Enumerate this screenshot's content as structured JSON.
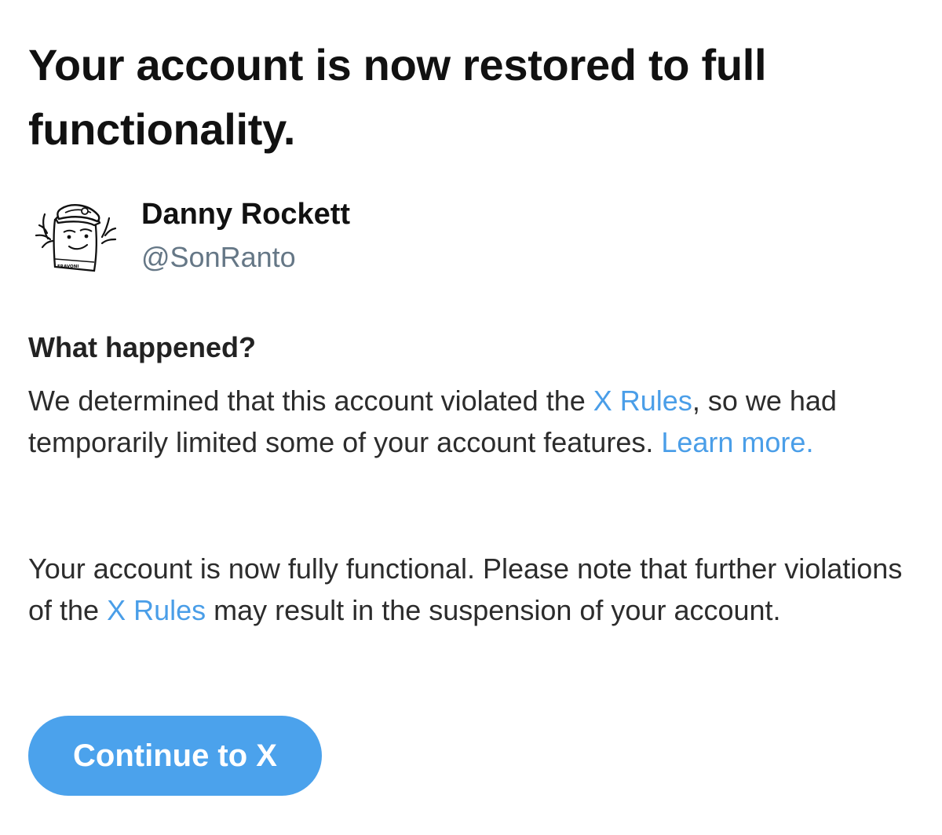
{
  "page": {
    "title": "Your account is now restored to full functionality."
  },
  "profile": {
    "display_name": "Danny Rockett",
    "handle": "@SonRanto",
    "avatar_label": "ERAVONI"
  },
  "details": {
    "heading": "What happened?",
    "paragraph_one": {
      "before_rules": "We determined that this account violated the ",
      "rules_link": "X Rules",
      "after_rules": ", so we had temporarily limited some of your account features. ",
      "learn_more_link": "Learn more."
    },
    "paragraph_two": {
      "before_rules": "Your account is now fully functional. Please note that further violations of the ",
      "rules_link": "X Rules",
      "after_rules": " may result in the suspension of your account."
    }
  },
  "actions": {
    "continue_label": "Continue to X"
  },
  "colors": {
    "link": "#4A9EE8",
    "button": "#4BA2EC",
    "secondary_text": "#657786"
  }
}
